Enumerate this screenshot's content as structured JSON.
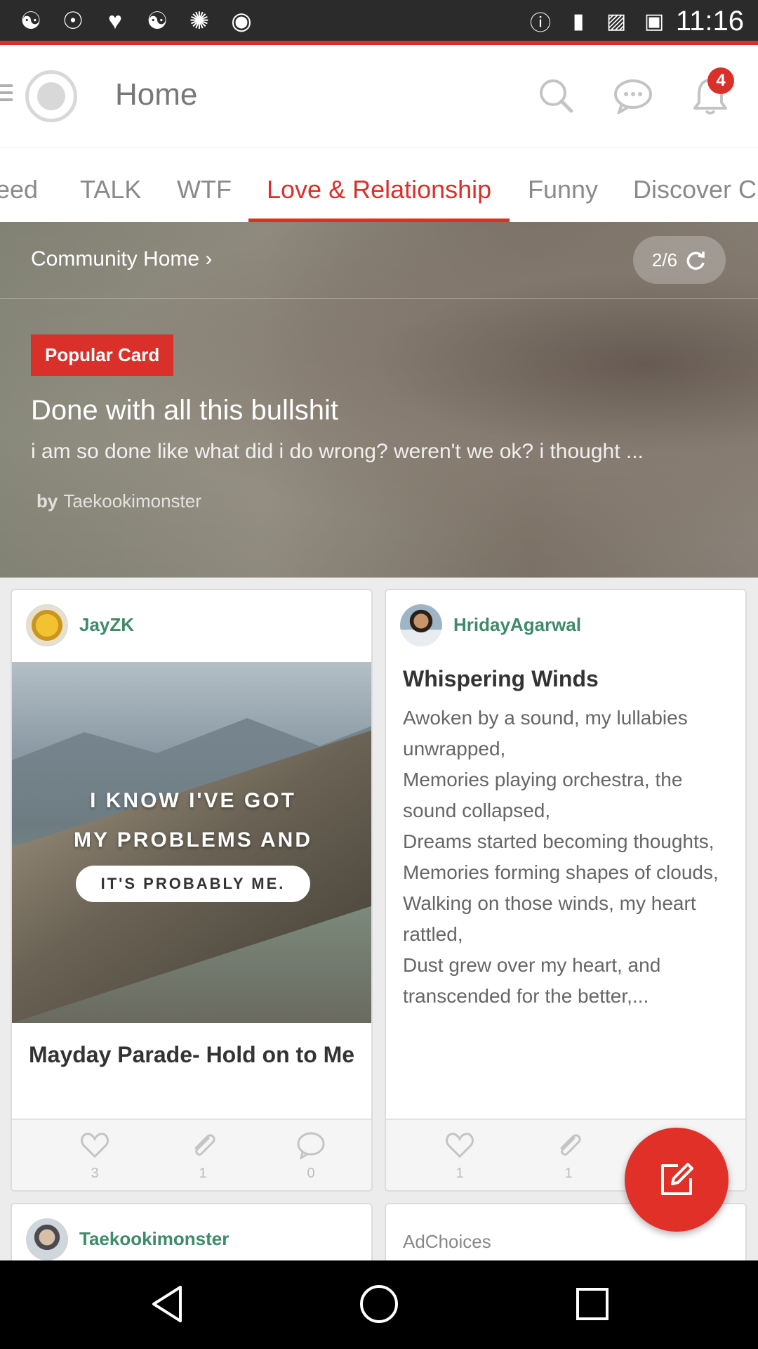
{
  "status_bar": {
    "time": "11:16",
    "notification_icons": [
      "photo-icon",
      "g-icon",
      "heart-icon",
      "photo-icon",
      "satellite-icon",
      "bag-icon",
      "vpn-icon",
      "lock-icon",
      "android-icon",
      "briefcase-icon"
    ]
  },
  "header": {
    "title": "Home",
    "notification_count": "4"
  },
  "tabs": [
    {
      "label": "Feed"
    },
    {
      "label": "TALK"
    },
    {
      "label": "WTF"
    },
    {
      "label": "Love & Relationship",
      "active": true
    },
    {
      "label": "Funny"
    },
    {
      "label": "Discover C"
    }
  ],
  "hero": {
    "community_link": "Community Home",
    "pager": "2/6",
    "badge": "Popular Card",
    "title": "Done with all this bullshit",
    "excerpt": "i am so done like what did i do wrong? weren't we ok? i thought ...",
    "author_prefix": "by",
    "author": "Taekookimonster"
  },
  "cards": {
    "jayzk": {
      "user": "JayZK",
      "image_text_line1": "I KNOW I'VE GOT",
      "image_text_line2": "MY PROBLEMS AND",
      "image_text_line3": "IT'S PROBABLY ME.",
      "title": "Mayday Parade- Hold on to Me",
      "likes": "3",
      "attachments": "1",
      "comments": "0"
    },
    "hriday": {
      "user": "HridayAgarwal",
      "title": "Whispering Winds",
      "body": [
        "Awoken by a sound, my lullabies unwrapped,",
        "Memories playing orchestra, the sound collapsed,",
        "Dreams started becoming thoughts,",
        "Memories forming shapes of clouds,",
        "Walking on those winds, my heart rattled,",
        "Dust grew over my heart, and transcended for the better,..."
      ],
      "likes": "1",
      "attachments": "1"
    },
    "taekook": {
      "user": "Taekookimonster"
    },
    "ad": {
      "label": "AdChoices"
    }
  },
  "colors": {
    "accent": "#d9302a",
    "username": "#3e8a6a"
  }
}
